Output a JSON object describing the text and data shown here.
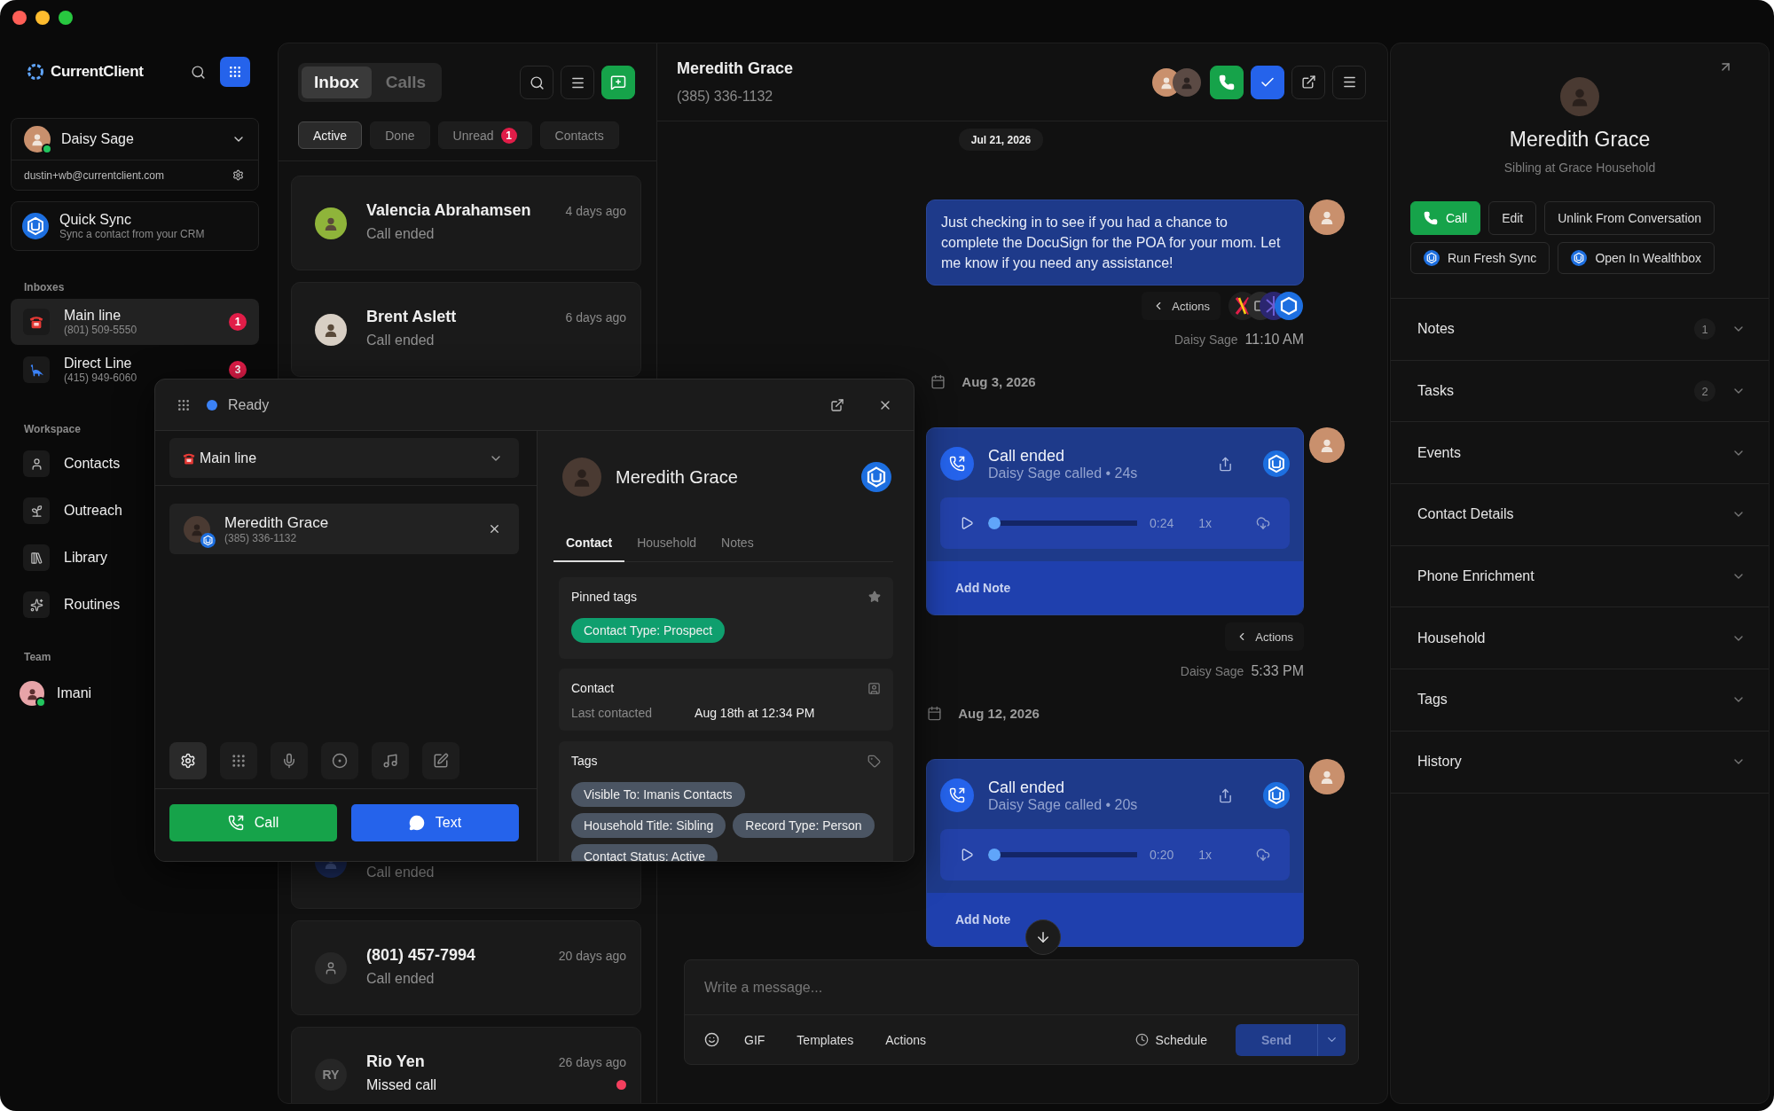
{
  "sidebar": {
    "brand": "CurrentClient",
    "user": {
      "name": "Daisy Sage",
      "email": "dustin+wb@currentclient.com",
      "online": true
    },
    "quick_sync": {
      "title": "Quick Sync",
      "subtitle": "Sync a contact from your CRM"
    },
    "inboxes": {
      "heading": "Inboxes",
      "items": [
        {
          "name": "Main line",
          "phone": "(801) 509-5550",
          "badge": "1",
          "selected": true
        },
        {
          "name": "Direct Line",
          "phone": "(415) 949-6060",
          "badge": "3",
          "selected": false
        }
      ]
    },
    "workspace": {
      "heading": "Workspace",
      "items": [
        {
          "name": "Contacts",
          "selected": false
        },
        {
          "name": "Outreach",
          "selected": false
        },
        {
          "name": "Library",
          "selected": false
        },
        {
          "name": "Routines",
          "selected": false
        }
      ]
    },
    "team": {
      "heading": "Team",
      "members": [
        {
          "name": "Imani",
          "online": true
        }
      ]
    }
  },
  "inbox": {
    "tabs": [
      {
        "label": "Inbox",
        "selected": true
      },
      {
        "label": "Calls",
        "selected": false
      }
    ],
    "filters": [
      {
        "label": "Active",
        "selected": true
      },
      {
        "label": "Done",
        "selected": false
      },
      {
        "label": "Unread",
        "badge": "1",
        "selected": false
      },
      {
        "label": "Contacts",
        "selected": false
      }
    ],
    "conversations": [
      {
        "kind": "photo",
        "name": "Valencia Abrahamsen",
        "time": "4 days ago",
        "preview": "Call ended",
        "unread": false
      },
      {
        "kind": "photo",
        "name": "Brent Aslett",
        "time": "6 days ago",
        "preview": "Call ended",
        "unread": false
      },
      {
        "kind": "logo",
        "preview": "Call ended",
        "unread": false
      },
      {
        "kind": "person",
        "name": "(801) 457-7994",
        "time": "20 days ago",
        "preview": "Call ended",
        "unread": false
      },
      {
        "kind": "initials",
        "initials": "RY",
        "name": "Rio Yen",
        "time": "26 days ago",
        "preview": "Missed call",
        "unread": true
      }
    ]
  },
  "chat": {
    "header": {
      "name": "Meredith Grace",
      "phone": "(385) 336-1132"
    },
    "sticky_date": "Jul 21, 2026",
    "timeline": [
      {
        "kind": "message",
        "text": "Just checking in to see if you had a chance to complete the DocuSign for the POA for your mom. Let me know if you need any assistance!",
        "actions": "Actions",
        "sender": "Daisy Sage",
        "time": "11:10 AM"
      },
      {
        "kind": "date",
        "text": "Aug 3, 2026"
      },
      {
        "kind": "call",
        "title": "Call ended",
        "summary": "Daisy Sage called • 24s",
        "elapsed": "0:24",
        "speed": "1x",
        "level": 0,
        "note": "Add Note",
        "actions": "Actions",
        "sender": "Daisy Sage",
        "time": "5:33 PM"
      },
      {
        "kind": "date",
        "text": "Aug 12, 2026"
      },
      {
        "kind": "call",
        "title": "Call ended",
        "summary": "Daisy Sage called • 20s",
        "elapsed": "0:20",
        "speed": "1x",
        "level": 0,
        "note": "Add Note"
      }
    ],
    "composer": {
      "placeholder": "Write a message...",
      "tools": [
        "GIF",
        "Templates",
        "Actions"
      ],
      "schedule": "Schedule",
      "send": "Send"
    }
  },
  "contact_panel": {
    "name": "Meredith Grace",
    "subtitle": "Sibling at Grace Household",
    "buttons": [
      {
        "kind": "primary",
        "label": "Call"
      },
      {
        "kind": "plain",
        "label": "Edit"
      },
      {
        "kind": "plain",
        "label": "Unlink From Conversation"
      },
      {
        "kind": "crm",
        "label": "Run Fresh Sync"
      },
      {
        "kind": "crm",
        "label": "Open In Wealthbox"
      }
    ],
    "sections": [
      {
        "title": "Notes",
        "count": "1",
        "expanded": false
      },
      {
        "title": "Tasks",
        "count": "2",
        "expanded": false
      },
      {
        "title": "Events",
        "expanded": false
      },
      {
        "title": "Contact Details",
        "expanded": false
      },
      {
        "title": "Phone Enrichment",
        "expanded": false
      },
      {
        "title": "Household",
        "expanded": false
      },
      {
        "title": "Tags",
        "expanded": false
      },
      {
        "title": "History",
        "expanded": false
      }
    ]
  },
  "dialer": {
    "status": "Ready",
    "line": "Main line",
    "recipient": {
      "name": "Meredith Grace",
      "phone": "(385) 336-1132"
    },
    "call": "Call",
    "text": "Text",
    "contact": {
      "name": "Meredith Grace",
      "tabs": [
        {
          "label": "Contact",
          "selected": true
        },
        {
          "label": "Household",
          "selected": false
        },
        {
          "label": "Notes",
          "selected": false
        }
      ],
      "pinned": {
        "title": "Pinned tags",
        "tags": [
          "Contact Type: Prospect"
        ]
      },
      "details": {
        "title": "Contact",
        "rows": [
          {
            "label": "Last contacted",
            "value": "Aug 18th at 12:34 PM"
          }
        ]
      },
      "tags": {
        "title": "Tags",
        "items": [
          "Visible To: Imanis Contacts",
          "Household Title: Sibling",
          "Record Type: Person",
          "Contact Status: Active"
        ]
      }
    }
  }
}
